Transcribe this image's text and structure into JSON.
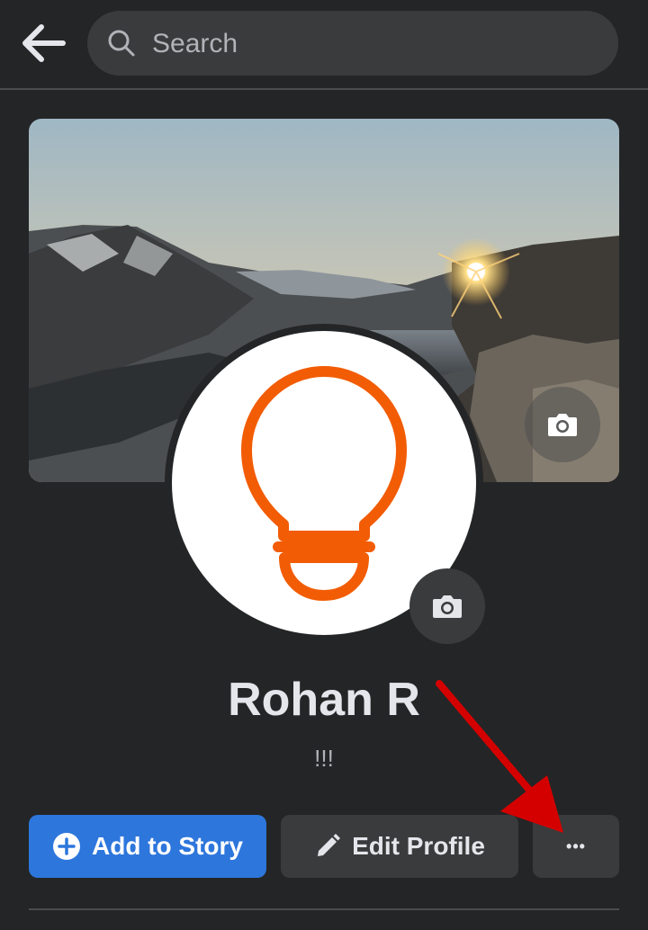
{
  "header": {
    "back_icon": "arrow-left-icon",
    "search_placeholder": "Search",
    "search_icon": "search-icon"
  },
  "profile": {
    "name": "Rohan R",
    "bio": "!!!",
    "avatar_icon": "lightbulb-icon",
    "cover_camera_icon": "camera-icon",
    "avatar_camera_icon": "camera-icon"
  },
  "actions": {
    "add_story_label": "Add to Story",
    "add_story_icon": "plus-circle-icon",
    "edit_profile_label": "Edit Profile",
    "edit_profile_icon": "pencil-icon",
    "more_label": "•••",
    "more_icon": "more-dots-icon"
  },
  "colors": {
    "background": "#242526",
    "primary_button": "#2d76dc",
    "secondary_button": "#3a3b3c",
    "avatar_accent": "#f25c05",
    "annotation_arrow": "#d40000"
  }
}
